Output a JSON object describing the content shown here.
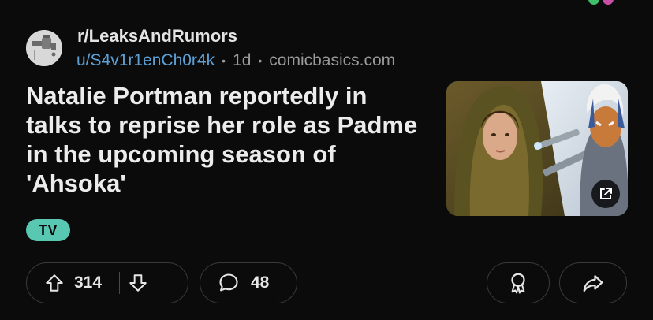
{
  "post": {
    "subreddit": "r/LeaksAndRumors",
    "author": "u/S4v1r1enCh0r4k",
    "age": "1d",
    "domain": "comicbasics.com",
    "separator": "•",
    "title": "Natalie Portman reportedly in talks to reprise her role as Padme in the upcoming season of 'Ahsoka'",
    "flair": "TV"
  },
  "actions": {
    "upvotes": "314",
    "comments": "48"
  },
  "icons": {
    "avatar": "faucet-avatar-icon",
    "upvote": "upvote-arrow-icon",
    "downvote": "downvote-arrow-icon",
    "comment": "comment-bubble-icon",
    "award": "award-ribbon-icon",
    "share": "share-arrow-icon",
    "external": "external-link-icon"
  },
  "colors": {
    "background": "#0b0b0b",
    "author_link": "#5ea1d6",
    "flair": "#58c8b2",
    "pill_border": "#3a3a3a"
  }
}
